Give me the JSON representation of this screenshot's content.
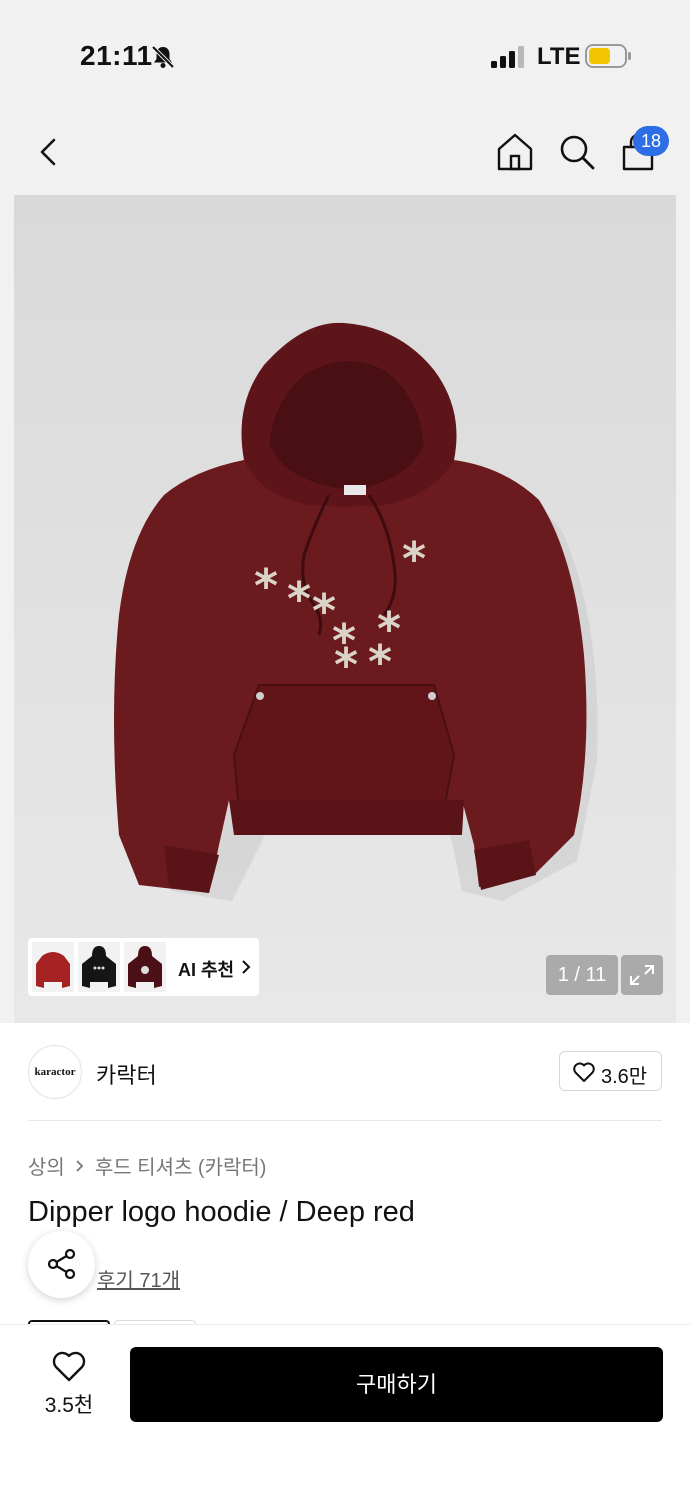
{
  "status_bar": {
    "time": "21:11",
    "network": "LTE",
    "icons": [
      "bell-off-icon",
      "signal-icon",
      "battery-icon"
    ]
  },
  "header": {
    "icons": [
      "back-icon",
      "home-icon",
      "search-icon",
      "shopping-bag-icon"
    ],
    "cart_count": "18",
    "accent_color": "#2d6ee6"
  },
  "gallery": {
    "ai_recommend_label": "AI 추천",
    "page_indicator": "1 / 11",
    "product_color": "#6b1a1e"
  },
  "brand": {
    "logo_text": "karactor",
    "name": "카락터",
    "likes": "3.6만"
  },
  "product": {
    "breadcrumb": [
      "상의",
      "후드 티셔츠 (카락터)"
    ],
    "title": "Dipper logo hoodie / Deep red",
    "review_link": "후기 71개"
  },
  "bottom_bar": {
    "wish_count": "3.5천",
    "buy_label": "구매하기"
  }
}
